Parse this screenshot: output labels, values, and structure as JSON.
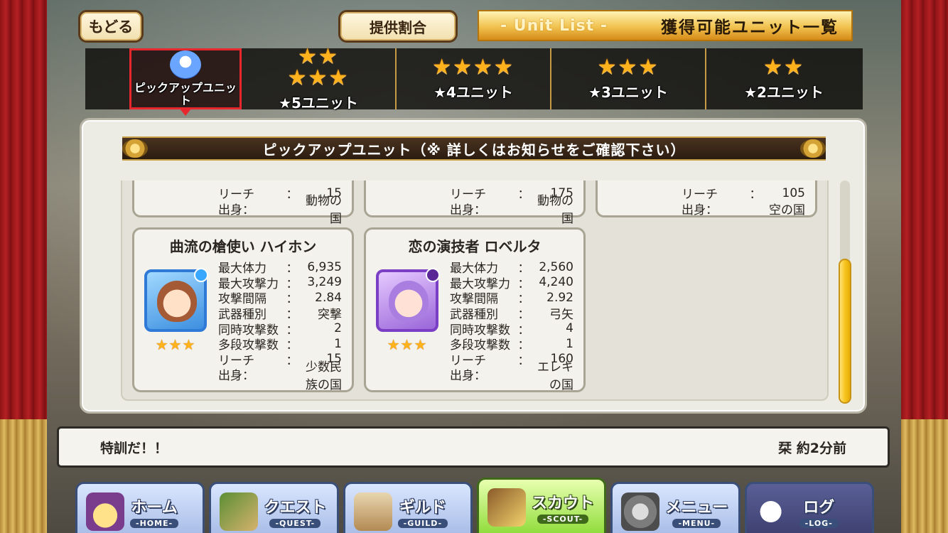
{
  "header": {
    "back_label": "もどる",
    "rates_label": "提供割合",
    "title_sub": "- Unit List -",
    "title_main": "獲得可能ユニット一覧"
  },
  "tabs": [
    {
      "stars": "",
      "label": "ピックアップユニット",
      "selected": true,
      "icon": "pickup-avatar-icon"
    },
    {
      "stars": "★★\n★★★",
      "label": "★5ユニット",
      "selected": false
    },
    {
      "stars": "★★★★",
      "label": "★4ユニット",
      "selected": false
    },
    {
      "stars": "★★★",
      "label": "★3ユニット",
      "selected": false
    },
    {
      "stars": "★★",
      "label": "★2ユニット",
      "selected": false
    }
  ],
  "section_title": "ピックアップユニット（※ 詳しくはお知らせをご確認下さい）",
  "partial_cards": [
    {
      "reach_label": "リーチ",
      "reach_value": "15",
      "origin_label": "出身：",
      "origin_value": "動物の国"
    },
    {
      "reach_label": "リーチ",
      "reach_value": "175",
      "origin_label": "出身：",
      "origin_value": "動物の国"
    },
    {
      "reach_label": "リーチ",
      "reach_value": "105",
      "origin_label": "出身：",
      "origin_value": "空の国"
    }
  ],
  "cards": [
    {
      "name": "曲流の槍使い ハイホン",
      "rarity": "★★★",
      "element": "water",
      "stats": [
        {
          "k": "最大体力",
          "c": "：",
          "v": "6,935"
        },
        {
          "k": "最大攻撃力",
          "c": "：",
          "v": "3,249"
        },
        {
          "k": "攻撃間隔",
          "c": "：",
          "v": "2.84"
        },
        {
          "k": "武器種別",
          "c": "：",
          "v": "突撃"
        },
        {
          "k": "同時攻撃数",
          "c": "：",
          "v": "2"
        },
        {
          "k": "多段攻撃数",
          "c": "：",
          "v": "1"
        },
        {
          "k": "リーチ",
          "c": "：",
          "v": "15"
        },
        {
          "k": "出身：",
          "c": "",
          "v": "少数民族の国"
        }
      ]
    },
    {
      "name": "恋の演技者 ロベルタ",
      "rarity": "★★★",
      "element": "dark",
      "stats": [
        {
          "k": "最大体力",
          "c": "：",
          "v": "2,560"
        },
        {
          "k": "最大攻撃力",
          "c": "：",
          "v": "4,240"
        },
        {
          "k": "攻撃間隔",
          "c": "：",
          "v": "2.92"
        },
        {
          "k": "武器種別",
          "c": "：",
          "v": "弓矢"
        },
        {
          "k": "同時攻撃数",
          "c": "：",
          "v": "4"
        },
        {
          "k": "多段攻撃数",
          "c": "：",
          "v": "1"
        },
        {
          "k": "リーチ",
          "c": "：",
          "v": "160"
        },
        {
          "k": "出身：",
          "c": "",
          "v": "エレキの国"
        }
      ]
    }
  ],
  "chat": {
    "message": "特訓だ！！",
    "meta": "栞 約2分前"
  },
  "nav": [
    {
      "jp": "ホーム",
      "en": "-HOME-",
      "icon": "home-icon",
      "active": false
    },
    {
      "jp": "クエスト",
      "en": "-QUEST-",
      "icon": "quest-icon",
      "active": false
    },
    {
      "jp": "ギルド",
      "en": "-GUILD-",
      "icon": "guild-icon",
      "active": false
    },
    {
      "jp": "スカウト",
      "en": "-SCOUT-",
      "icon": "scout-icon",
      "active": true
    },
    {
      "jp": "メニュー",
      "en": "-MENU-",
      "icon": "gear-icon",
      "active": false
    },
    {
      "jp": "ログ",
      "en": "-LOG-",
      "icon": "chat-bubble-icon",
      "active": false
    }
  ],
  "colors": {
    "accent_gold": "#f1c24f",
    "selected_tab_border": "#e8262e",
    "star": "#ffb21c",
    "scroll_thumb": "#f7c51e"
  }
}
